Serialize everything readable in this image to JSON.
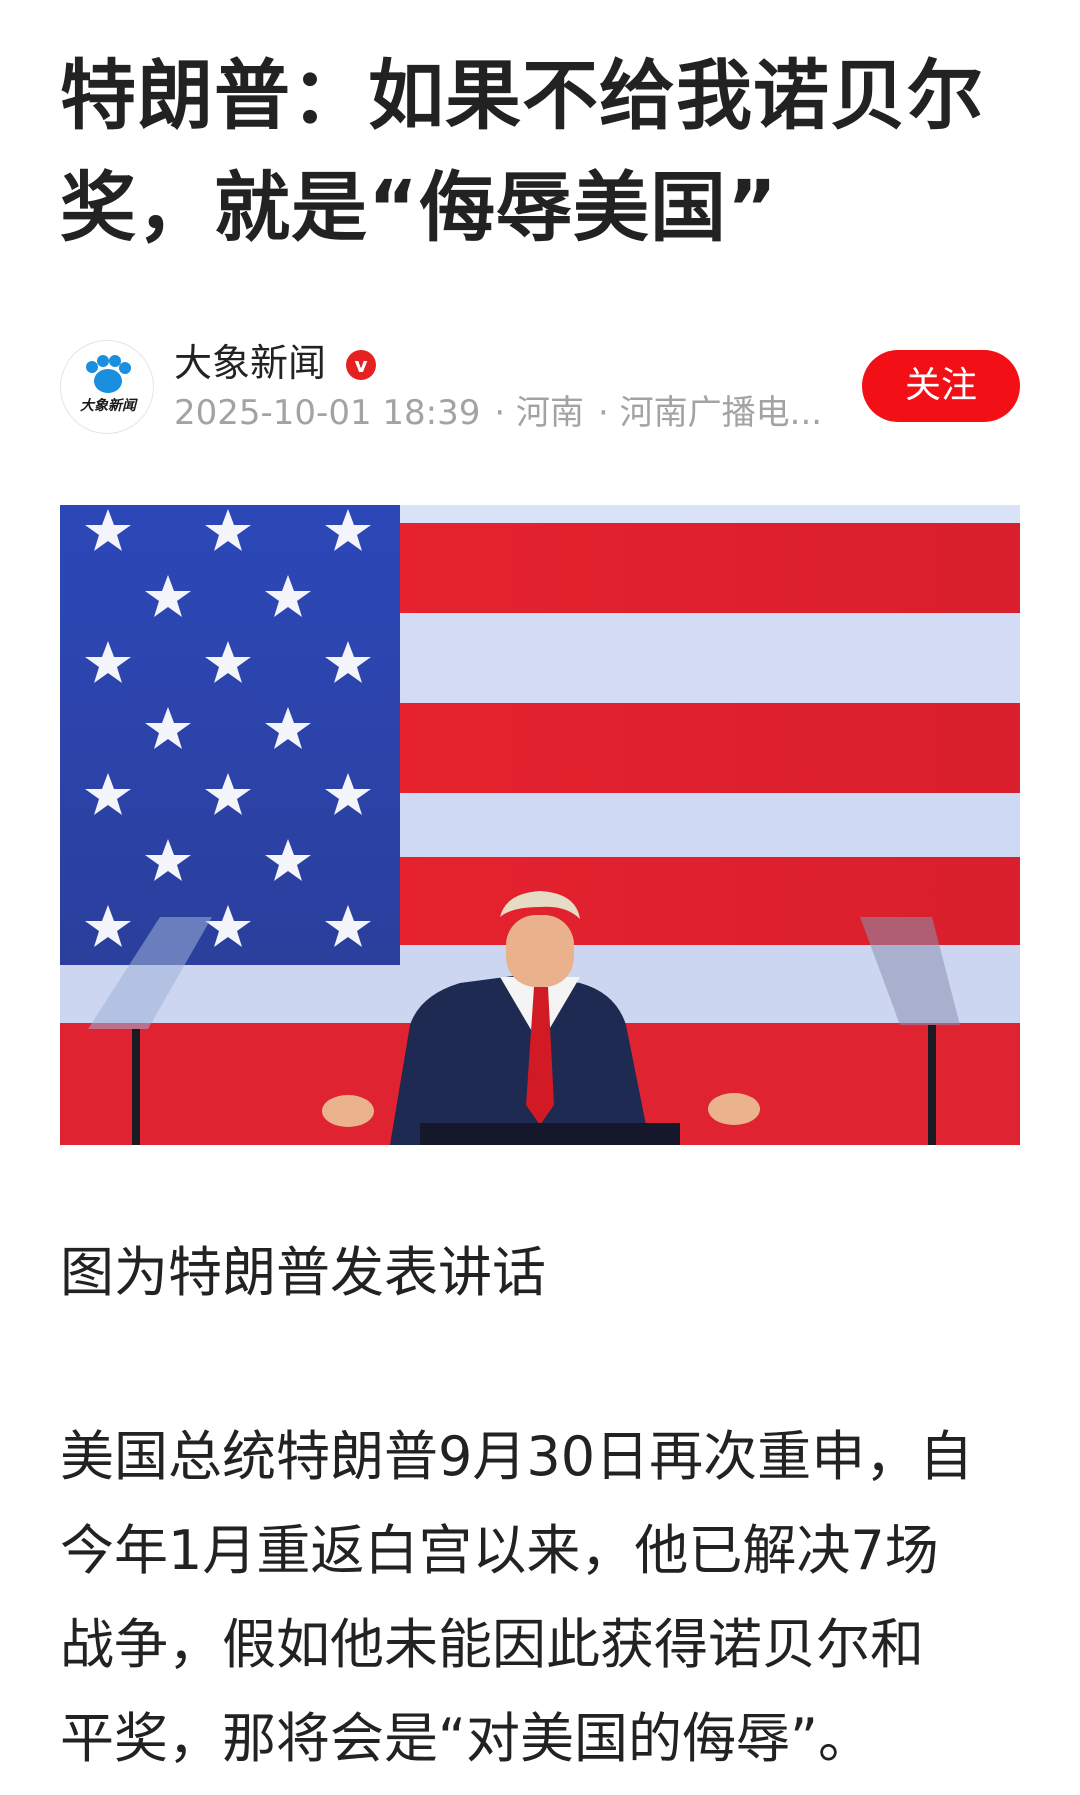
{
  "article": {
    "title_line1": "特朗普：如果不给我诺贝尔",
    "title_line2": "奖，就是“侮辱美国”"
  },
  "author": {
    "name": "大象新闻",
    "logo_text": "大象新闻",
    "verified_mark": "v",
    "date": "2025-10-01 18:39",
    "location": "· 河南",
    "source": "· 河南广播电...",
    "follow_label": "关注"
  },
  "image": {
    "icon": "photo-speech-podium",
    "caption": "图为特朗普发表讲话"
  },
  "body": {
    "lines": [
      "美国总统特朗普9月30日再次重申，自",
      "今年1月重返白宫以来，他已解决7场",
      "战争，假如他未能因此获得诺贝尔和",
      "平奖，那将会是“对美国的侮辱”。"
    ]
  },
  "colors": {
    "accent": "#f20f15",
    "verified": "#e52222",
    "text": "#222222",
    "meta": "#a3a3a3",
    "logo_blue": "#1a8fe0"
  }
}
